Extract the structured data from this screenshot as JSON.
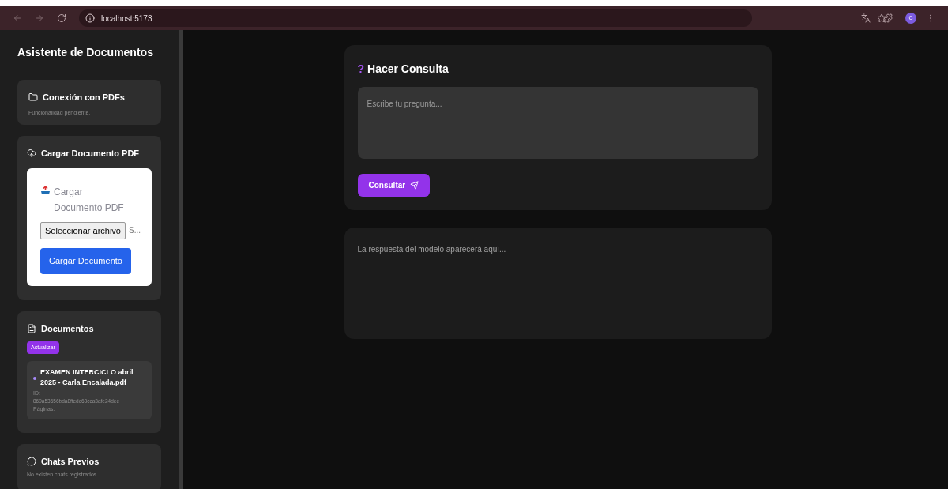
{
  "browser": {
    "url": "localhost:5173",
    "profile_initial": "C"
  },
  "sidebar": {
    "title": "Asistente de Documentos",
    "pdf_connection": {
      "title": "Conexión con PDFs",
      "note": "Funcionalidad pendiente."
    },
    "upload": {
      "title": "Cargar Documento PDF",
      "inner_title": "Cargar Documento PDF",
      "file_button": "Seleccionar archivo",
      "file_status": "S...",
      "submit": "Cargar Documento"
    },
    "documents": {
      "title": "Documentos",
      "refresh": "Actualizar",
      "items": [
        {
          "name": "EXAMEN INTERCICLO abril 2025 - Carla Encalada.pdf",
          "id_label": "ID:",
          "id": "869a53656bda8ffedc63cca3afe24dec",
          "pages_label": "Páginas:"
        }
      ]
    },
    "chats": {
      "title": "Chats Previos",
      "empty": "No existen chats registrados."
    }
  },
  "query": {
    "title": "Hacer Consulta",
    "icon": "?",
    "placeholder": "Escribe tu pregunta...",
    "submit": "Consultar"
  },
  "answer": {
    "text": "La respuesta del modelo aparecerá aquí..."
  }
}
